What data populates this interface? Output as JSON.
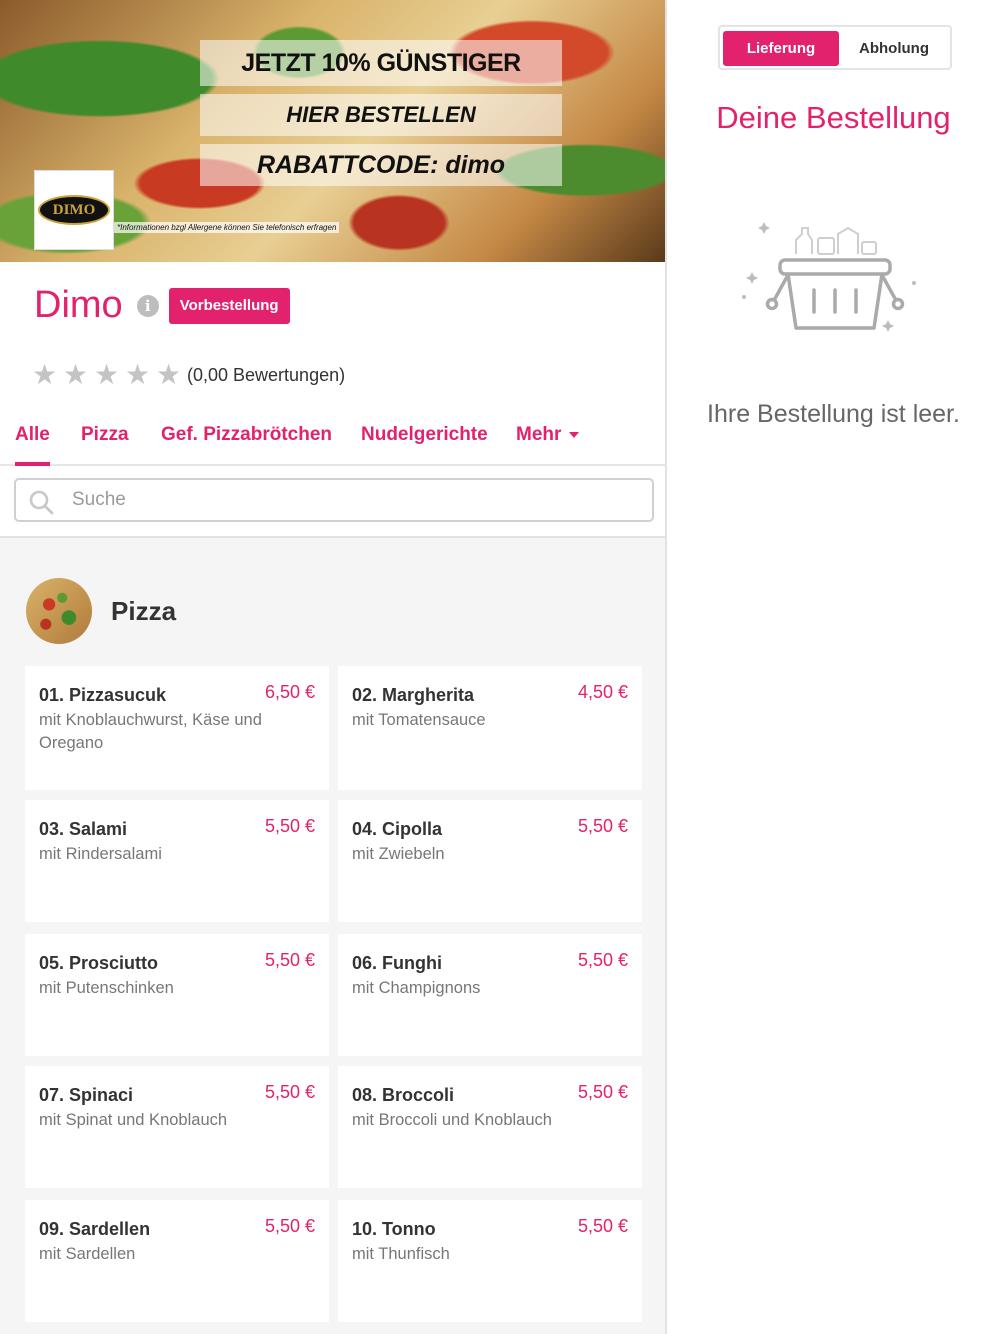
{
  "hero": {
    "band1": "JETZT 10% GÜNSTIGER",
    "band2": "HIER BESTELLEN",
    "band3": "RABATTCODE: dimo",
    "logo_text": "DIMO",
    "note": "*Informationen bzgl Allergene können Sie telefonisch erfragen"
  },
  "shop": {
    "name": "Dimo",
    "info_icon": "info-icon",
    "preorder_label": "Vorbestellung",
    "rating_text": "(0,00 Bewertungen)",
    "stars": 0
  },
  "tabs": [
    {
      "label": "Alle"
    },
    {
      "label": "Pizza"
    },
    {
      "label": "Gef. Pizzabrötchen"
    },
    {
      "label": "Nudelgerichte"
    },
    {
      "label": "Mehr"
    }
  ],
  "search": {
    "placeholder": "Suche"
  },
  "category": {
    "title": "Pizza"
  },
  "items": [
    {
      "name": "01. Pizzasucuk",
      "price": "6,50 €",
      "desc": "mit Knoblauchwurst, Käse und Oregano"
    },
    {
      "name": "02. Margherita",
      "price": "4,50 €",
      "desc": "mit Tomatensauce"
    },
    {
      "name": "03. Salami",
      "price": "5,50 €",
      "desc": "mit Rindersalami"
    },
    {
      "name": "04. Cipolla",
      "price": "5,50 €",
      "desc": "mit Zwiebeln"
    },
    {
      "name": "05. Prosciutto",
      "price": "5,50 €",
      "desc": "mit Putenschinken"
    },
    {
      "name": "06. Funghi",
      "price": "5,50 €",
      "desc": "mit Champignons"
    },
    {
      "name": "07. Spinaci",
      "price": "5,50 €",
      "desc": "mit Spinat und Knoblauch"
    },
    {
      "name": "08. Broccoli",
      "price": "5,50 €",
      "desc": "mit Broccoli und Knoblauch"
    },
    {
      "name": "09. Sardellen",
      "price": "5,50 €",
      "desc": "mit Sardellen"
    },
    {
      "name": "10. Tonno",
      "price": "5,50 €",
      "desc": "mit Thunfisch"
    }
  ],
  "order": {
    "delivery_label": "Lieferung",
    "pickup_label": "Abholung",
    "title": "Deine Bestellung",
    "empty_text": "Ihre Bestellung ist leer."
  },
  "colors": {
    "accent": "#e3226d",
    "background": "#f5f5f5"
  }
}
